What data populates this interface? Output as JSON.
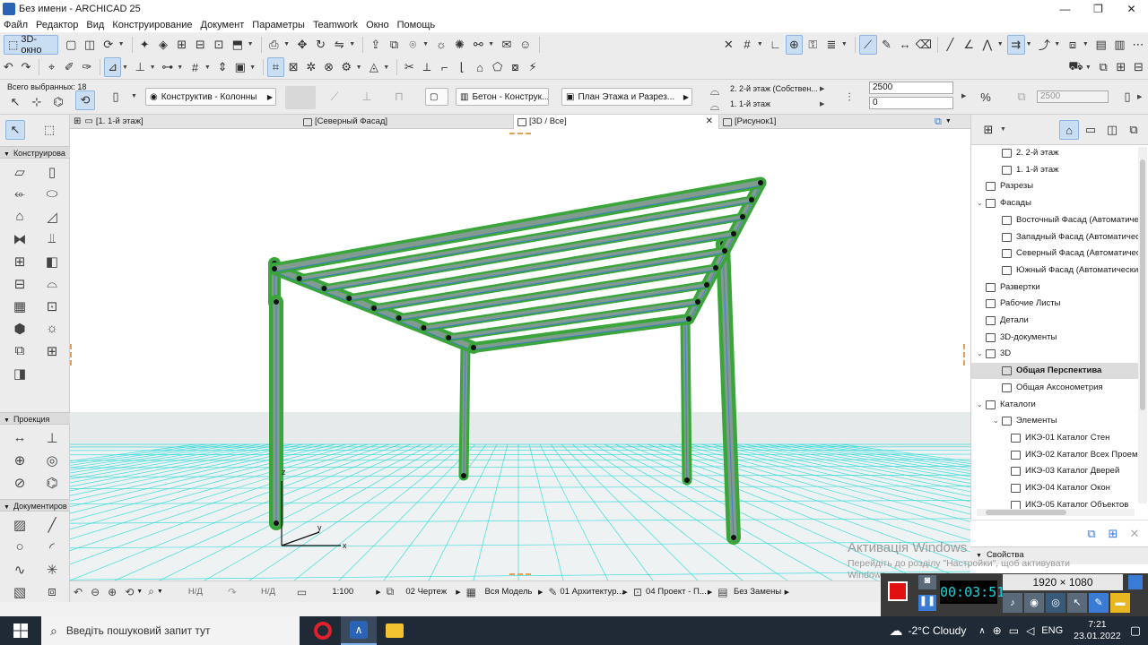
{
  "window": {
    "title": "Без имени - ARCHICAD 25",
    "controls": [
      "—",
      "❐",
      "✕"
    ]
  },
  "menu": [
    "Файл",
    "Редактор",
    "Вид",
    "Конструирование",
    "Документ",
    "Параметры",
    "Teamwork",
    "Окно",
    "Помощь"
  ],
  "toolbar": {
    "btn3d_label": "3D-окно"
  },
  "infobox": {
    "selected": "Всего выбранных: 18",
    "layer": "Конструктив - Колонны",
    "material": "Бетон - Конструк...",
    "floorplan": "План Этажа и Разрез...",
    "story_top": "2. 2-й этаж (Собствен...",
    "story_bottom": "1. 1-й этаж",
    "height_value": "2500",
    "offset_value": "0",
    "right_value": "2500"
  },
  "tabs": [
    {
      "label": "[1. 1-й этаж]"
    },
    {
      "label": "[Северный Фасад]"
    },
    {
      "label": "[3D / Все]"
    },
    {
      "label": "[Рисунок1]"
    }
  ],
  "toolbox": {
    "section1": "Конструирова",
    "section2": "Проекция",
    "section3": "Документиров"
  },
  "viewport": {
    "axis_x": "x",
    "axis_y": "y",
    "axis_z": "z"
  },
  "statusbar": {
    "undo": "↶",
    "nd1": "Н/Д",
    "nd2": "Н/Д",
    "scale": "1:100",
    "layer_combo": "02 Чертеж",
    "model": "Вся Модель",
    "arch": "01 Архитектур...",
    "project": "04 Проект - П...",
    "renovation": "Без Замены"
  },
  "navigator": {
    "items": [
      {
        "label": "2. 2-й этаж",
        "level": 2,
        "arrow": ""
      },
      {
        "label": "1. 1-й этаж",
        "level": 2,
        "arrow": ""
      },
      {
        "label": "Разрезы",
        "level": 1,
        "arrow": ""
      },
      {
        "label": "Фасады",
        "level": 1,
        "arrow": "⌄"
      },
      {
        "label": "Восточный Фасад (Автоматическ",
        "level": 2,
        "arrow": ""
      },
      {
        "label": "Западный Фасад (Автоматически",
        "level": 2,
        "arrow": ""
      },
      {
        "label": "Северный Фасад (Автоматическ",
        "level": 2,
        "arrow": ""
      },
      {
        "label": "Южный Фасад (Автоматически П",
        "level": 2,
        "arrow": ""
      },
      {
        "label": "Развертки",
        "level": 1,
        "arrow": ""
      },
      {
        "label": "Рабочие Листы",
        "level": 1,
        "arrow": ""
      },
      {
        "label": "Детали",
        "level": 1,
        "arrow": ""
      },
      {
        "label": "3D-документы",
        "level": 1,
        "arrow": ""
      },
      {
        "label": "3D",
        "level": 1,
        "arrow": "⌄"
      },
      {
        "label": "Общая Перспектива",
        "level": 2,
        "arrow": "",
        "selected": true
      },
      {
        "label": "Общая Аксонометрия",
        "level": 2,
        "arrow": ""
      },
      {
        "label": "Каталоги",
        "level": 1,
        "arrow": "⌄"
      },
      {
        "label": "Элементы",
        "level": 2,
        "arrow": "⌄"
      },
      {
        "label": "ИКЭ-01 Каталог Стен",
        "level": 3,
        "arrow": ""
      },
      {
        "label": "ИКЭ-02 Каталог Всех Проемов",
        "level": 3,
        "arrow": ""
      },
      {
        "label": "ИКЭ-03 Каталог Дверей",
        "level": 3,
        "arrow": ""
      },
      {
        "label": "ИКЭ-04 Каталог Окон",
        "level": 3,
        "arrow": ""
      },
      {
        "label": "ИКЭ-05 Каталог Объектов",
        "level": 3,
        "arrow": ""
      }
    ],
    "properties_label": "Свойства"
  },
  "watermark": {
    "line1": "Активація Windows",
    "line2": "Перейдіть до розділу \"Настройки\", щоб активувати",
    "line3": "Windows"
  },
  "recorder": {
    "resolution": "1920 × 1080",
    "timer": "00:03:51"
  },
  "taskbar": {
    "search_placeholder": "Введіть пошуковий запит тут",
    "weather": "-2°C  Cloudy",
    "lang": "ENG",
    "time": "7:21",
    "date": "23.01.2022"
  },
  "colors": {
    "beam_green": "#3aa63a",
    "beam_core": "#8a9a9a",
    "grid_cyan": "#25d9d9",
    "selection_blue": "#3a7bd5"
  }
}
